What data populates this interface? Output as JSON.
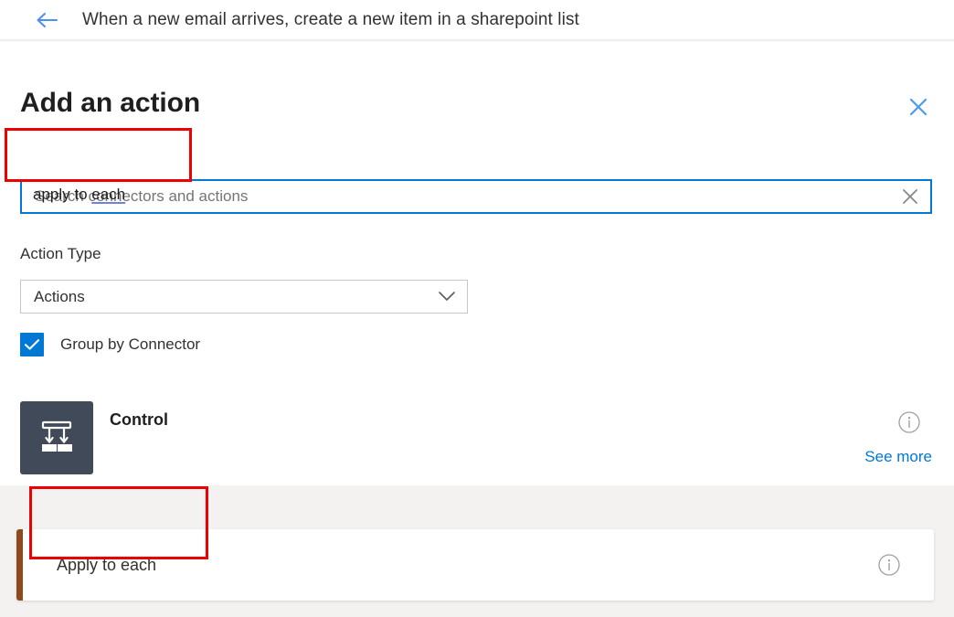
{
  "flow_header": {
    "back_icon": "back-arrow-icon",
    "title": "When a new email arrives, create a new item in a sharepoint list"
  },
  "panel": {
    "title": "Add an action",
    "close_icon": "close-icon",
    "search": {
      "value": "apply to each",
      "value_prefix": "apply to ",
      "value_misspelled": "each",
      "placeholder": "Search connectors and actions",
      "clear_icon": "clear-x-icon"
    },
    "action_type": {
      "label": "Action Type",
      "selected": "Actions",
      "caret_icon": "chevron-down-icon"
    },
    "group_by_connector": {
      "label": "Group by Connector",
      "checked": true,
      "check_icon": "checkmark-icon"
    },
    "connector": {
      "name": "Control",
      "icon": "control-flow-icon",
      "info_icon": "info-icon",
      "see_more": "See more"
    },
    "results": [
      {
        "label": "Apply to each",
        "accent_color": "#8e4a1e",
        "info_icon": "info-icon"
      }
    ]
  },
  "colors": {
    "accent_blue": "#0078d4",
    "annotation_red": "#ee0000",
    "connector_tile": "#414a58",
    "result_accent": "#8e4a1e"
  }
}
